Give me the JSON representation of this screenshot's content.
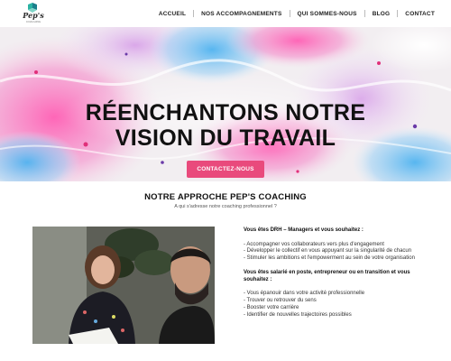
{
  "logo": {
    "text": "Pep's",
    "subtext": "COACHING"
  },
  "nav": {
    "items": [
      "ACCUEIL",
      "NOS ACCOMPAGNEMENTS",
      "QUI SOMMES-NOUS",
      "BLOG",
      "CONTACT"
    ]
  },
  "hero": {
    "title_line1": "RÉENCHANTONS NOTRE",
    "title_line2": "VISION DU TRAVAIL",
    "cta_label": "CONTACTEZ-NOUS"
  },
  "approach": {
    "title": "NOTRE APPROCHE PEP'S COACHING",
    "subtitle": "A qui s'adresse notre coaching professionnel ?",
    "photo_alt": "Photo coaching session"
  },
  "content": {
    "heading1": "Vous êtes DRH – Managers et vous souhaitez :",
    "list1": [
      "- Accompagner vos collaborateurs vers plus d'engagement",
      "- Développer le collectif en vous appuyant sur la singularité de chacun",
      "- Stimuler les ambitions et l'empowerment au sein de votre organisation"
    ],
    "heading2": "Vous êtes salarié en poste, entrepreneur ou en transition et vous souhaitez :",
    "list2": [
      "- Vous épanouir dans votre activité professionnelle",
      "- Trouver ou retrouver du sens",
      "- Booster votre carrière",
      "- Identifier de nouvelles trajectoires possibles"
    ]
  },
  "colors": {
    "accent": "#e94a7c",
    "logo_teal": "#2bb3a3"
  }
}
